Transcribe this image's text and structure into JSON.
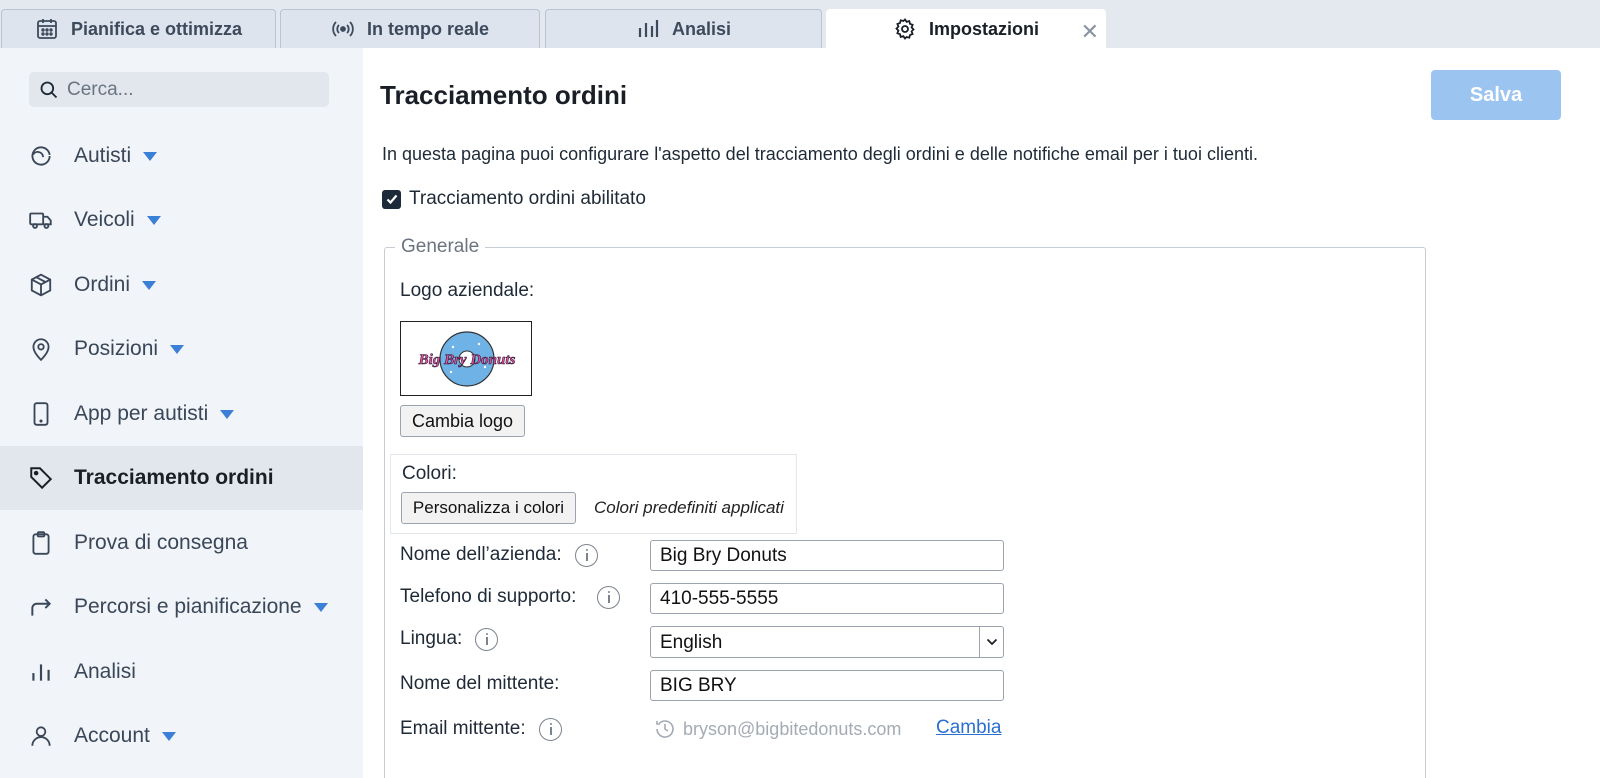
{
  "tabs": [
    {
      "label": "Pianifica e ottimizza",
      "icon": "calendar-icon"
    },
    {
      "label": "In tempo reale",
      "icon": "broadcast-icon"
    },
    {
      "label": "Analisi",
      "icon": "bar-chart-icon"
    },
    {
      "label": "Impostazioni",
      "icon": "gear-icon",
      "active": true
    }
  ],
  "tab_close": "✕",
  "sidebar": {
    "search_placeholder": "Cerca...",
    "items": [
      {
        "label": "Autisti",
        "icon": "steering-wheel-icon",
        "has_caret": true
      },
      {
        "label": "Veicoli",
        "icon": "truck-icon",
        "has_caret": true
      },
      {
        "label": "Ordini",
        "icon": "box-icon",
        "has_caret": true
      },
      {
        "label": "Posizioni",
        "icon": "map-pin-icon",
        "has_caret": true
      },
      {
        "label": "App per autisti",
        "icon": "phone-icon",
        "has_caret": true
      },
      {
        "label": "Tracciamento ordini",
        "icon": "tag-icon",
        "active": true
      },
      {
        "label": "Prova di consegna",
        "icon": "clipboard-icon"
      },
      {
        "label": "Percorsi e pianificazione",
        "icon": "route-arrow-icon",
        "has_caret": true
      },
      {
        "label": "Analisi",
        "icon": "bar-chart-icon"
      },
      {
        "label": "Account",
        "icon": "user-icon",
        "has_caret": true
      }
    ]
  },
  "main": {
    "title": "Tracciamento ordini",
    "save_label": "Salva",
    "intro": "In questa pagina puoi configurare l'aspetto del tracciamento degli ordini e delle notifiche email per i tuoi clienti.",
    "enable_label": "Tracciamento ordini abilitato",
    "enable_checked": true,
    "section_legend": "Generale",
    "logo_label": "Logo aziendale:",
    "logo_text": "Big Bry Donuts",
    "change_logo": "Cambia logo",
    "colors_label": "Colori:",
    "customize_colors": "Personalizza i colori",
    "colors_note": "Colori predefiniti applicati",
    "company_name_label": "Nome dell’azienda:",
    "company_name_value": "Big Bry Donuts",
    "support_phone_label": "Telefono di supporto:",
    "support_phone_value": "410-555-5555",
    "language_label": "Lingua:",
    "language_value": "English",
    "sender_name_label": "Nome del mittente:",
    "sender_name_value": "BIG BRY",
    "sender_email_label": "Email mittente:",
    "sender_email_value": "bryson@bigbitedonuts.com",
    "change_link": "Cambia"
  },
  "colors": {
    "accent": "#3c7fd6",
    "save_disabled": "#9cc4f0",
    "link": "#2a6fd1"
  }
}
